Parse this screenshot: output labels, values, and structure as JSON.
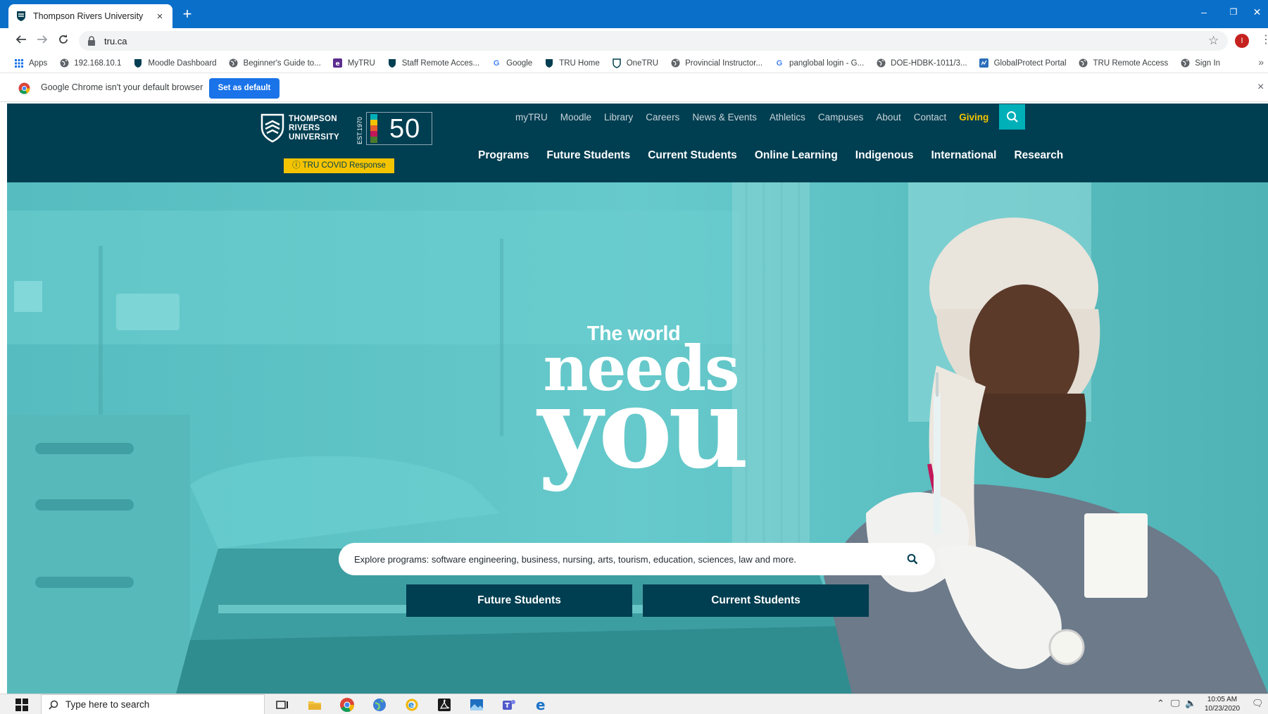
{
  "browser": {
    "tab_title": "Thompson Rivers University",
    "tab_close": "×",
    "new_tab": "+",
    "url": "tru.ca",
    "window_controls": {
      "minimize": "–",
      "restore": "❐",
      "close": "✕"
    },
    "profile_initial": "I"
  },
  "bookmarks": [
    {
      "label": "Apps",
      "icon": "apps-grid-icon"
    },
    {
      "label": "192.168.10.1",
      "icon": "globe-icon"
    },
    {
      "label": "Moodle Dashboard",
      "icon": "tru-shield-icon"
    },
    {
      "label": "Beginner's Guide to...",
      "icon": "globe-icon"
    },
    {
      "label": "MyTRU",
      "icon": "mytru-icon"
    },
    {
      "label": "Staff Remote Acces...",
      "icon": "tru-shield-icon"
    },
    {
      "label": "Google",
      "icon": "google-g-icon"
    },
    {
      "label": "TRU Home",
      "icon": "tru-shield-icon"
    },
    {
      "label": "OneTRU",
      "icon": "onetru-shield-icon"
    },
    {
      "label": "Provincial Instructor...",
      "icon": "globe-icon"
    },
    {
      "label": "panglobal login - G...",
      "icon": "google-g-icon"
    },
    {
      "label": "DOE-HDBK-1011/3...",
      "icon": "globe-icon"
    },
    {
      "label": "GlobalProtect Portal",
      "icon": "globalprotect-icon"
    },
    {
      "label": "TRU Remote Access",
      "icon": "globe-icon"
    },
    {
      "label": "Sign In",
      "icon": "globe-icon"
    }
  ],
  "bookmarks_more": "»",
  "infobar": {
    "message": "Google Chrome isn't your default browser",
    "button": "Set as default",
    "close": "×"
  },
  "site": {
    "logo_lines": [
      "THOMPSON",
      "RIVERS",
      "UNIVERSITY"
    ],
    "est": "EST.1970",
    "anniversary": "50",
    "covid_button": "ⓘ TRU COVID Response",
    "utility_nav": [
      "myTRU",
      "Moodle",
      "Library",
      "Careers",
      "News & Events",
      "Athletics",
      "Campuses",
      "About",
      "Contact",
      "Giving"
    ],
    "main_nav": [
      "Programs",
      "Future Students",
      "Current Students",
      "Online Learning",
      "Indigenous",
      "International",
      "Research"
    ]
  },
  "hero": {
    "line1": "The world",
    "line2": "needs",
    "line3": "you",
    "search_placeholder": "Explore programs: software engineering, business, nursing, arts, tourism, education, sciences, law and more.",
    "cta_future": "Future Students",
    "cta_current": "Current Students"
  },
  "taskbar": {
    "search_text": "Type here to search",
    "time": "10:05 AM",
    "date": "10/23/2020"
  },
  "colors": {
    "chrome_blue": "#0a6fc9",
    "tru_navy": "#003e51",
    "tru_teal": "#00b0b9",
    "tru_yellow": "#f5c400",
    "hero_teal": "#63c8ca"
  }
}
